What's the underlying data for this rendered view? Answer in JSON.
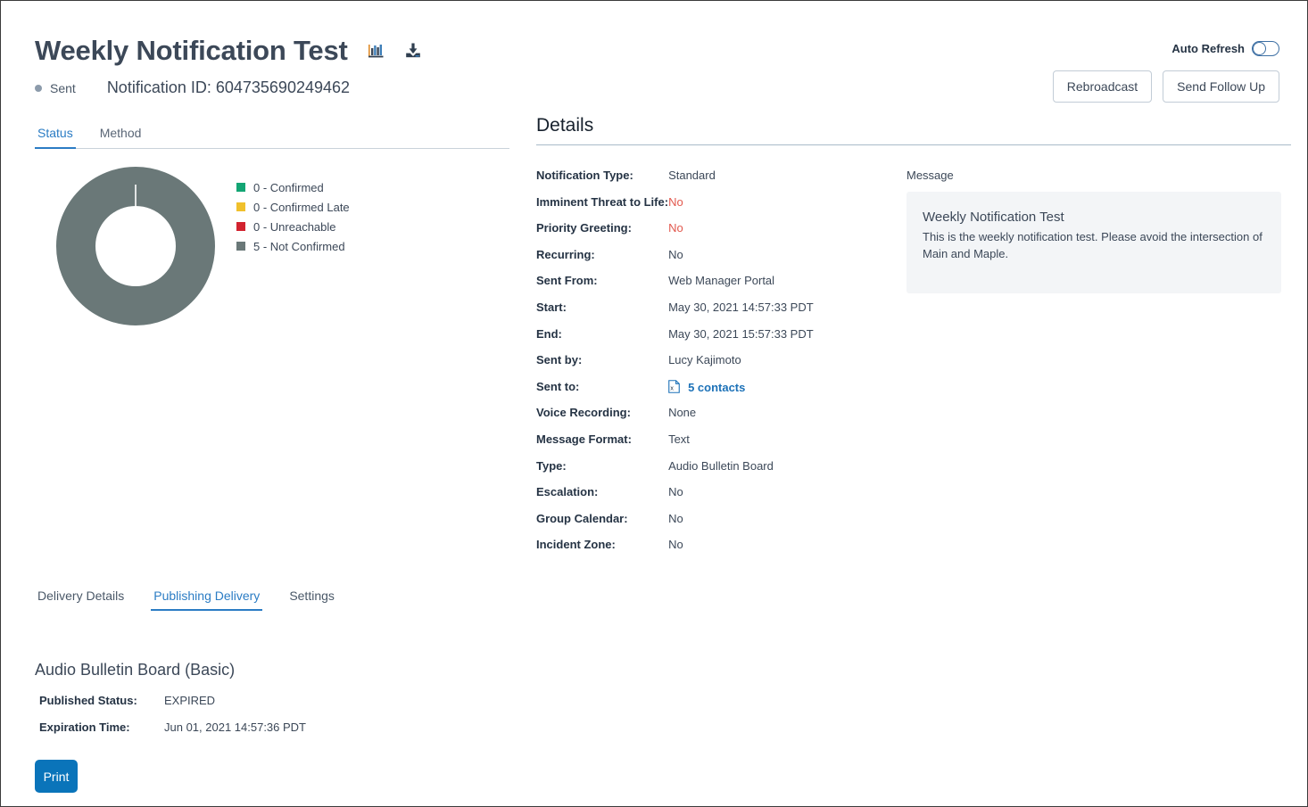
{
  "header": {
    "title": "Weekly Notification Test",
    "status": "Sent",
    "notification_id_label": "Notification ID: 604735690249462",
    "chart_icon": "bar-chart-icon",
    "download_icon": "download-icon",
    "auto_refresh_label": "Auto Refresh",
    "auto_refresh_on": false,
    "rebroadcast_label": "Rebroadcast",
    "follow_up_label": "Send Follow Up"
  },
  "left": {
    "tabs": [
      {
        "label": "Status",
        "active": true
      },
      {
        "label": "Method",
        "active": false
      }
    ]
  },
  "chart_data": {
    "type": "pie",
    "title": "",
    "legend_position": "right",
    "hole": 0.52,
    "categories": [
      "Confirmed",
      "Confirmed Late",
      "Unreachable",
      "Not Confirmed"
    ],
    "values": [
      0,
      0,
      0,
      5
    ],
    "colors": [
      "#13a574",
      "#f0c02c",
      "#d2232f",
      "#6a7878"
    ],
    "legend": [
      "0 - Confirmed",
      "0 - Confirmed Late",
      "0 - Unreachable",
      "5 - Not Confirmed"
    ]
  },
  "details": {
    "title": "Details",
    "rows": [
      {
        "key": "Notification Type:",
        "value": "Standard",
        "warn": false
      },
      {
        "key": "Imminent Threat to Life:",
        "value": "No",
        "warn": true
      },
      {
        "key": "Priority Greeting:",
        "value": "No",
        "warn": true
      },
      {
        "key": "Recurring:",
        "value": "No",
        "warn": false
      },
      {
        "key": "Sent From:",
        "value": "Web Manager Portal",
        "warn": false
      },
      {
        "key": "Start:",
        "value": "May 30, 2021 14:57:33 PDT",
        "warn": false
      },
      {
        "key": "End:",
        "value": "May 30, 2021 15:57:33 PDT",
        "warn": false
      },
      {
        "key": "Sent by:",
        "value": "Lucy Kajimoto",
        "warn": false
      }
    ],
    "sent_to": {
      "key": "Sent to:",
      "icon": "spreadsheet-file-icon",
      "link_label": "5  contacts"
    },
    "rows2": [
      {
        "key": "Voice Recording:",
        "value": "None",
        "warn": false
      },
      {
        "key": "Message Format:",
        "value": "Text",
        "warn": false
      },
      {
        "key": "Type:",
        "value": "Audio Bulletin Board",
        "warn": false
      },
      {
        "key": "Escalation:",
        "value": "No",
        "warn": false
      },
      {
        "key": "Group Calendar:",
        "value": "No",
        "warn": false
      },
      {
        "key": "Incident Zone:",
        "value": "No",
        "warn": false
      }
    ],
    "message": {
      "caption": "Message",
      "title": "Weekly Notification Test",
      "body": "This is the weekly notification test. Please avoid the intersection of Main and Maple."
    }
  },
  "bottom": {
    "tabs": [
      {
        "label": "Delivery Details",
        "active": false
      },
      {
        "label": "Publishing Delivery",
        "active": true
      },
      {
        "label": "Settings",
        "active": false
      }
    ],
    "publish": {
      "title": "Audio Bulletin Board (Basic)",
      "status_key": "Published Status:",
      "status_value": "EXPIRED",
      "expiration_key": "Expiration Time:",
      "expiration_value": "Jun 01, 2021 14:57:36 PDT",
      "print_label": "Print"
    }
  },
  "colors": {
    "accent": "#2b7cc4",
    "print_button": "#0a74ba",
    "warn_text": "#e2584d",
    "link": "#1d72b8",
    "not_confirmed": "#6a7878"
  }
}
